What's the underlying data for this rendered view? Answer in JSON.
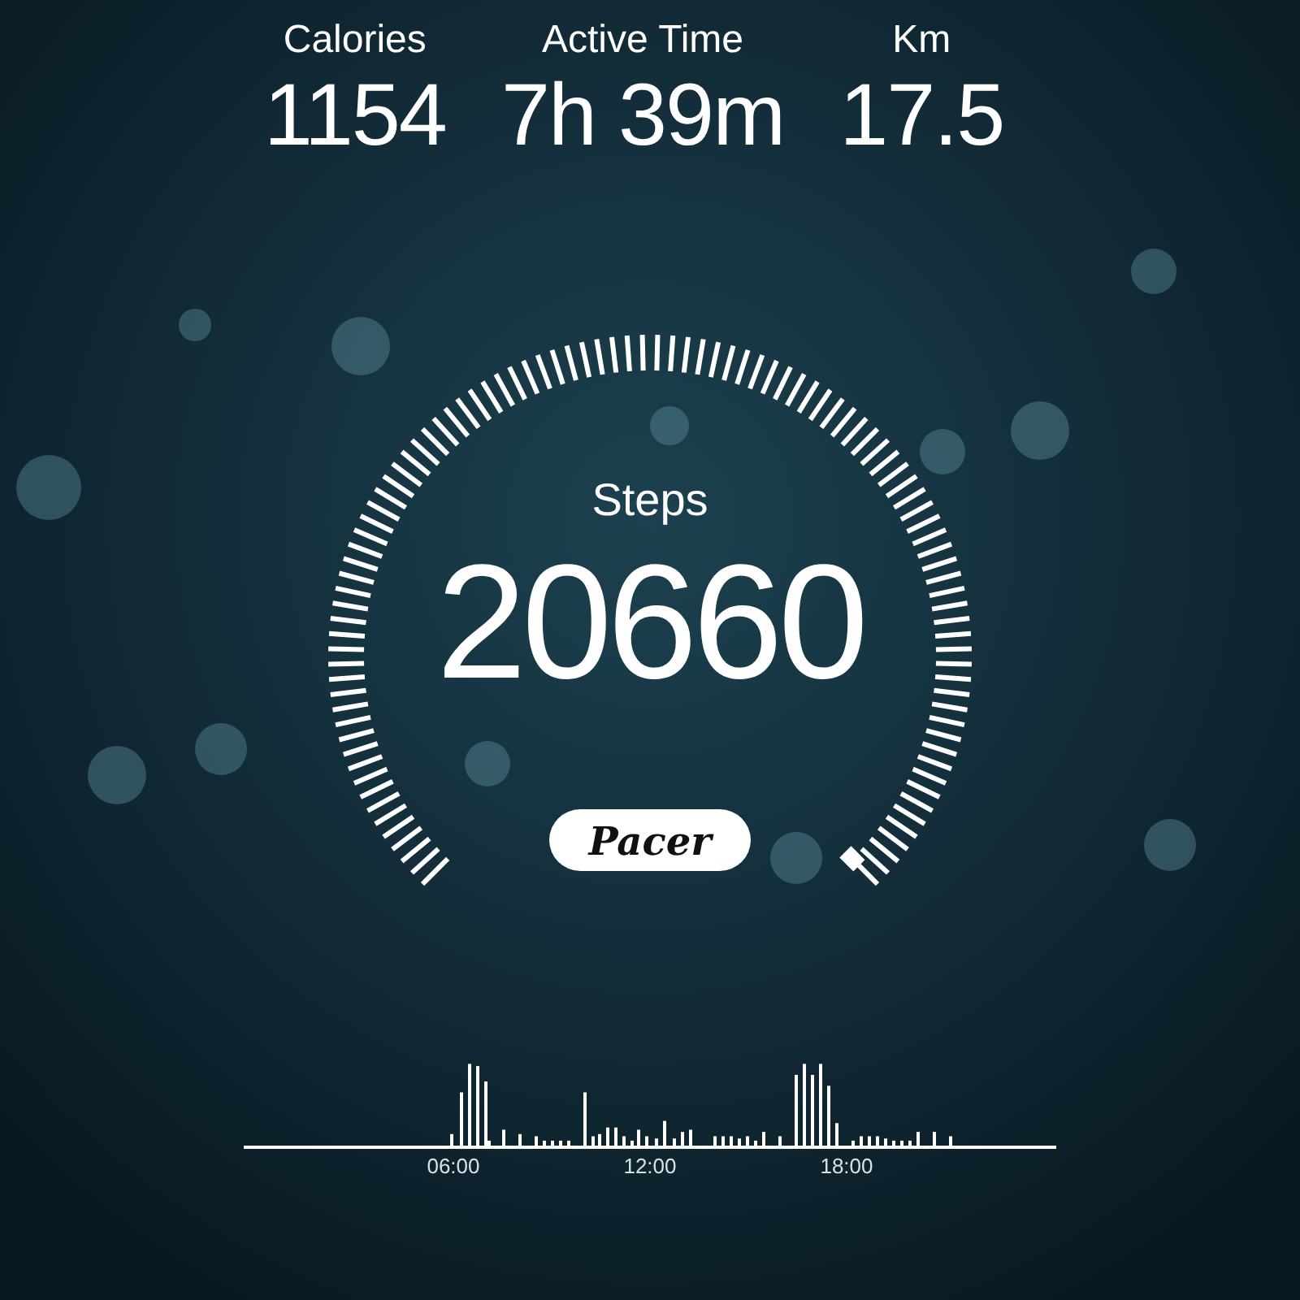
{
  "stats": [
    {
      "label": "Calories",
      "value": "1154"
    },
    {
      "label": "Active Time",
      "value": "7h 39m"
    },
    {
      "label": "Km",
      "value": "17.5"
    }
  ],
  "steps": {
    "label": "Steps",
    "value": "20660"
  },
  "brand_button": {
    "label": "Pacer"
  },
  "activity_chart": {
    "tick_labels": [
      "06:00",
      "12:00",
      "18:00"
    ]
  }
}
